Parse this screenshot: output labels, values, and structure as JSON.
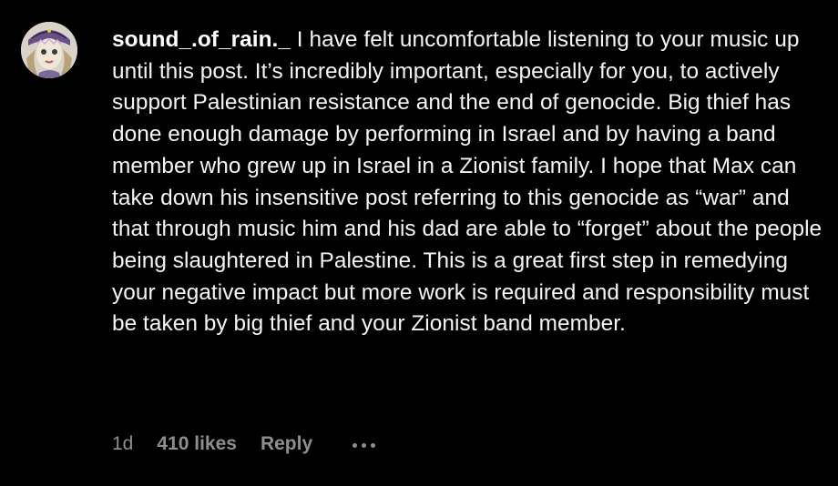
{
  "comment": {
    "username": "sound_.of_rain._",
    "text": " I have felt uncomfortable listening to your music up until this post. It’s incredibly important, especially for you, to actively support Palestinian resistance and the end of genocide. Big thief has done enough damage by performing in Israel and by having a band member who grew up in Israel in a Zionist family. I hope that Max can take down his insensitive post referring to this genocide as “war” and that through music him and his dad are able to “forget” about the people being slaughtered in Palestine. This is a great first step in remedying your negative impact but more work is required and responsibility must be taken by big thief and your Zionist band member.",
    "time": "1d",
    "likes": "410 likes",
    "reply_label": "Reply",
    "more_icon": "more-horizontal-icon",
    "avatar_icon": "profile-avatar"
  },
  "colors": {
    "background": "#000000",
    "text": "#f5f5f5",
    "meta": "#8e8e8e"
  }
}
